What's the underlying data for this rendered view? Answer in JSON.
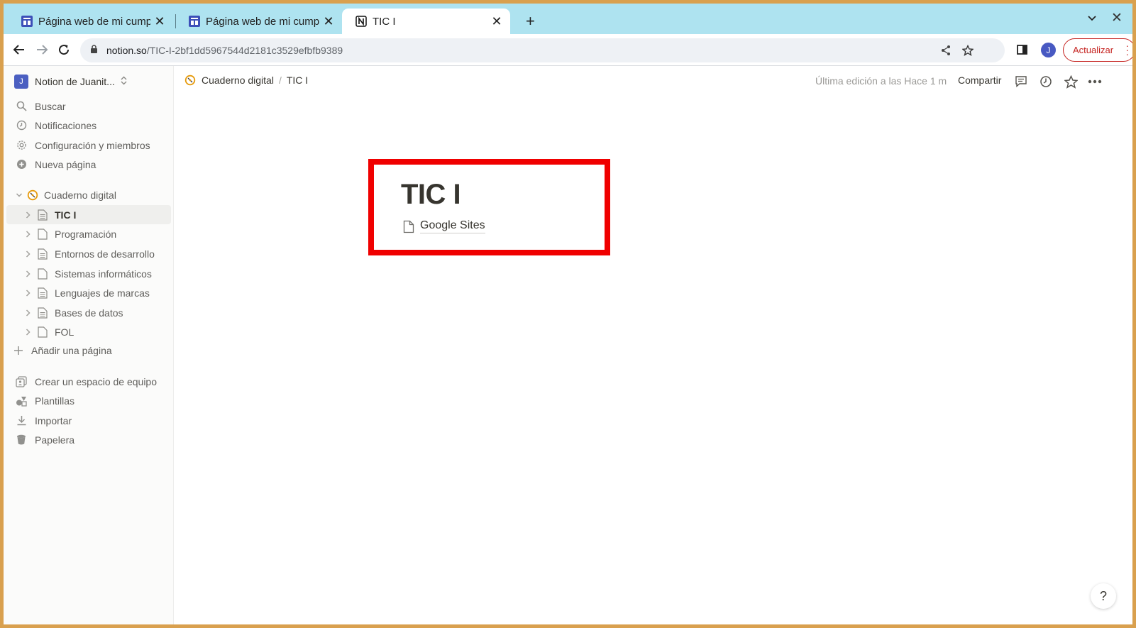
{
  "browser": {
    "tabs": [
      {
        "title": "Página web de mi cumpleaños",
        "favicon": "site-icon"
      },
      {
        "title": "Página web de mi cumpleaños",
        "favicon": "site-icon"
      },
      {
        "title": "TIC I",
        "favicon": "notion-icon"
      }
    ],
    "new_tab": "+",
    "close_glyph": "✕",
    "url_host": "notion.so",
    "url_path": "/TIC-I-2bf1dd5967544d2181c3529efbfb9389",
    "profile_initial": "J",
    "update_label": "Actualizar"
  },
  "sidebar": {
    "workspace_initial": "J",
    "workspace_name": "Notion de Juanit...",
    "menu": [
      {
        "label": "Buscar",
        "icon": "search-icon"
      },
      {
        "label": "Notificaciones",
        "icon": "clock-icon"
      },
      {
        "label": "Configuración y miembros",
        "icon": "gear-icon"
      },
      {
        "label": "Nueva página",
        "icon": "plus-circle-icon"
      }
    ],
    "root_page": "Cuaderno digital",
    "pages": [
      "TIC I",
      "Programación",
      "Entornos de desarrollo",
      "Sistemas informáticos",
      "Lenguajes de marcas",
      "Bases de datos",
      "FOL"
    ],
    "add_page": "Añadir una página",
    "bottom": [
      {
        "label": "Crear un espacio de equipo",
        "icon": "team-icon"
      },
      {
        "label": "Plantillas",
        "icon": "templates-icon"
      },
      {
        "label": "Importar",
        "icon": "download-icon"
      },
      {
        "label": "Papelera",
        "icon": "trash-icon"
      }
    ]
  },
  "main": {
    "breadcrumb": [
      "Cuaderno digital",
      "TIC I"
    ],
    "breadcrumb_sep": "/",
    "last_edited": "Última edición a las Hace 1 m",
    "share": "Compartir",
    "title": "TIC I",
    "sub_page": "Google Sites",
    "help": "?"
  },
  "colors": {
    "highlight_border": "#f00000",
    "tab_strip": "#aee3f0",
    "update_red": "#c5221f"
  }
}
